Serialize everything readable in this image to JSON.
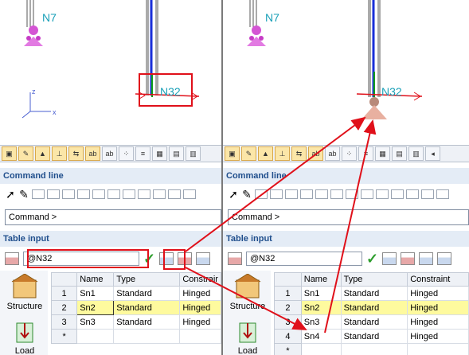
{
  "colors": {
    "accent_red": "#e0101a",
    "selection": "#fefa9e",
    "section_text": "#1f4e8c",
    "node_label": "#1aa0b8"
  },
  "left": {
    "nodes": {
      "n7": "N7",
      "n32": "N32"
    },
    "axis": {
      "x": "x",
      "z": "z"
    },
    "command_line": {
      "title": "Command line",
      "value": "Command >"
    },
    "table_input": {
      "title": "Table input",
      "value": "@N32"
    },
    "sidebar": {
      "structure": "Structure",
      "load": "Load"
    },
    "grid": {
      "headers": [
        "",
        "Name",
        "Type",
        "Constrair"
      ],
      "rows": [
        {
          "n": "1",
          "name": "Sn1",
          "type": "Standard",
          "constraint": "Hinged"
        },
        {
          "n": "2",
          "name": "Sn2",
          "type": "Standard",
          "constraint": "Hinged"
        },
        {
          "n": "3",
          "name": "Sn3",
          "type": "Standard",
          "constraint": "Hinged"
        },
        {
          "n": "*",
          "name": "",
          "type": "",
          "constraint": ""
        }
      ]
    }
  },
  "right": {
    "nodes": {
      "n7": "N7",
      "n32": "N32"
    },
    "command_line": {
      "title": "Command line",
      "value": "Command >"
    },
    "table_input": {
      "title": "Table input",
      "value": "@N32"
    },
    "sidebar": {
      "structure": "Structure",
      "load": "Load"
    },
    "grid": {
      "headers": [
        "",
        "Name",
        "Type",
        "Constraint"
      ],
      "rows": [
        {
          "n": "1",
          "name": "Sn1",
          "type": "Standard",
          "constraint": "Hinged"
        },
        {
          "n": "2",
          "name": "Sn2",
          "type": "Standard",
          "constraint": "Hinged"
        },
        {
          "n": "3",
          "name": "Sn3",
          "type": "Standard",
          "constraint": "Hinged"
        },
        {
          "n": "4",
          "name": "Sn4",
          "type": "Standard",
          "constraint": "Hinged"
        },
        {
          "n": "*",
          "name": "",
          "type": "",
          "constraint": ""
        }
      ]
    }
  },
  "icons": {
    "toolbar": [
      "tb-support-icon",
      "tb-pencil-icon",
      "tb-load-icon",
      "tb-member-icon",
      "tb-beam-icon",
      "tb-abc-icon",
      "tb-abc-icon",
      "tb-mesh-icon",
      "tb-list-icon",
      "tb-grid-icon",
      "tb-table-icon",
      "tb-chart-icon"
    ],
    "command": [
      "select-arrow-icon",
      "pencil-icon"
    ]
  }
}
